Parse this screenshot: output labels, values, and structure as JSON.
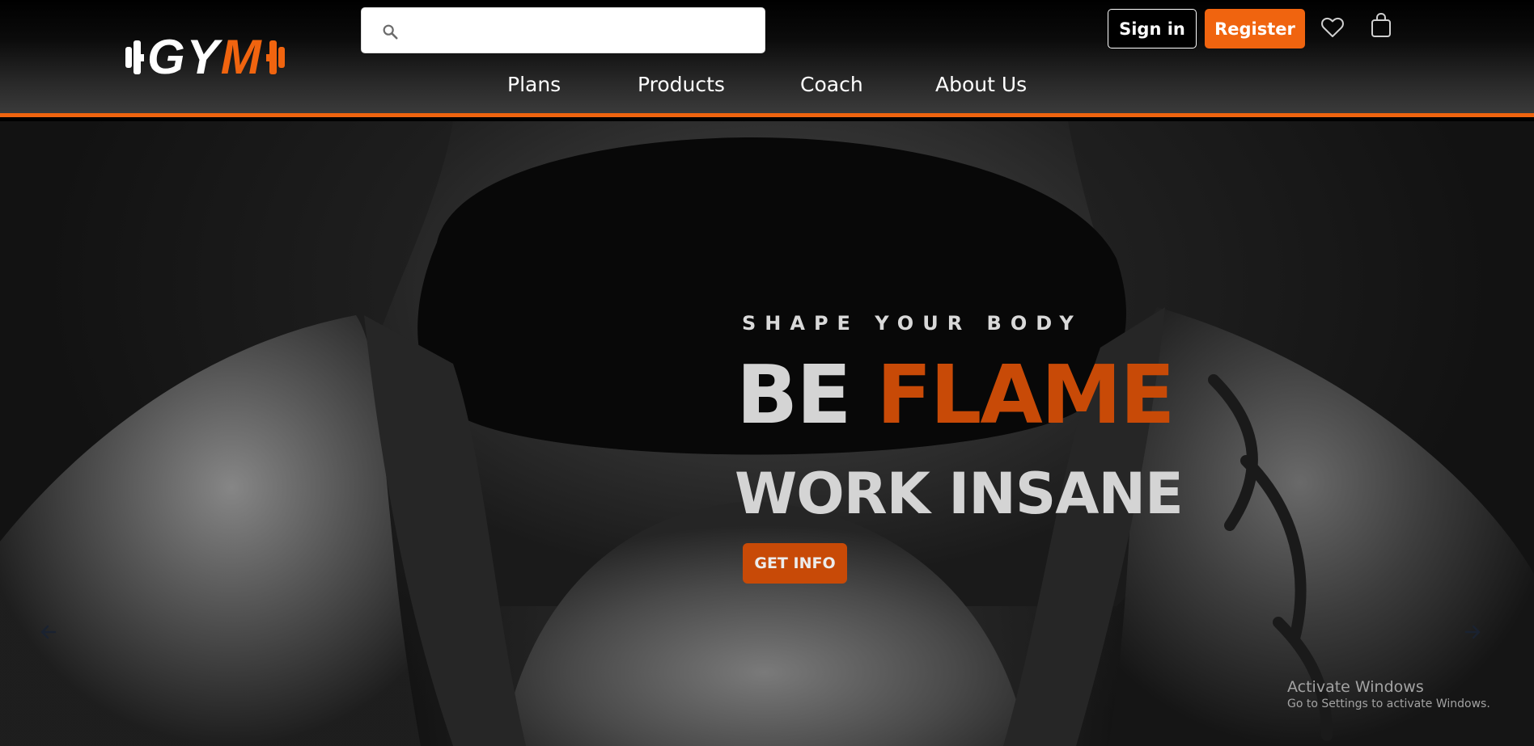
{
  "brand": {
    "logo_text_white": "GY",
    "logo_text_orange": "M",
    "accent_color": "#f0640f",
    "accent_dark": "#c84a07"
  },
  "search": {
    "value": "",
    "placeholder": "",
    "icon": "search-icon"
  },
  "nav": {
    "items": [
      {
        "label": "Plans"
      },
      {
        "label": "Products"
      },
      {
        "label": "Coach"
      },
      {
        "label": "About Us"
      }
    ]
  },
  "account": {
    "sign_in_label": "Sign in",
    "register_label": "Register",
    "wishlist_icon": "heart-icon",
    "cart_icon": "shopping-bag-icon"
  },
  "hero": {
    "tagline": "SHAPE YOUR BODY",
    "headline_word_1": "BE",
    "headline_word_2": "FLAME",
    "subheadline": "WORK INSANE",
    "cta_label": "GET INFO",
    "prev_icon": "arrow-left-icon",
    "next_icon": "arrow-right-icon"
  },
  "watermark": {
    "line1": "Activate Windows",
    "line2": "Go to Settings to activate Windows."
  }
}
